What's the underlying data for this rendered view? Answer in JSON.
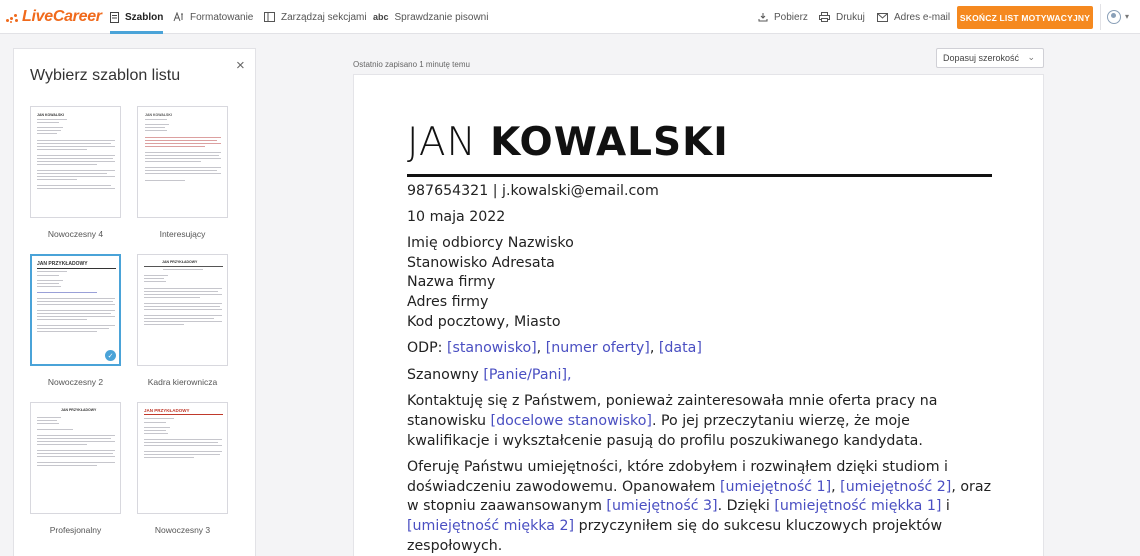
{
  "logo": {
    "text": "LiveCareer"
  },
  "nav": {
    "tabs": [
      {
        "label": "Szablon",
        "icon": "document-icon"
      },
      {
        "label": "Formatowanie",
        "icon": "format-icon"
      },
      {
        "label": "Zarządzaj sekcjami",
        "icon": "sections-icon"
      },
      {
        "label": "Sprawdzanie pisowni",
        "icon": "spellcheck-icon"
      }
    ],
    "actions": [
      {
        "label": "Pobierz",
        "icon": "download-icon"
      },
      {
        "label": "Drukuj",
        "icon": "print-icon"
      },
      {
        "label": "Adres e-mail",
        "icon": "mail-icon"
      }
    ],
    "finish_button": "SKOŃCZ LIST MOTYWACYJNY",
    "spellcheck_glyph": "abc"
  },
  "panel": {
    "title": "Wybierz szablon listu",
    "close": "×",
    "templates": [
      {
        "label": "Nowoczesny 4",
        "heading": "JAN KOWALSKI"
      },
      {
        "label": "Interesujący",
        "heading": "JAN KOWALSKI"
      },
      {
        "label": "Nowoczesny 2",
        "heading": "JAN PRZYKŁADOWY"
      },
      {
        "label": "Kadra kierownicza",
        "heading": "JAN PRZYKŁADOWY"
      },
      {
        "label": "Profesjonalny",
        "heading": "JAN PRZYKŁADOWY"
      },
      {
        "label": "Nowoczesny 3",
        "heading": "JAN PRZYKŁADOWY"
      }
    ],
    "selected_check": "✓"
  },
  "main": {
    "saved_status": "Ostatnio zapisano 1 minutę temu",
    "zoom": "Dopasuj szerokość"
  },
  "letter": {
    "first_name": "JAN",
    "last_name": "KOWALSKI",
    "contact": "987654321 | j.kowalski@email.com",
    "date": "10 maja 2022",
    "recipient_lines": [
      "Imię odbiorcy Nazwisko",
      "Stanowisko Adresata",
      "Nazwa firmy",
      "Adres firmy",
      "Kod pocztowy, Miasto"
    ],
    "re_prefix": "ODP: ",
    "re_position": "[stanowisko]",
    "re_sep1": ", ",
    "re_number": "[numer oferty]",
    "re_sep2": ", ",
    "re_date": "[data]",
    "greeting_prefix": "Szanowny ",
    "greeting_name": "[Panie/Pani],",
    "p1_a": "Kontaktuję się z Państwem, ponieważ zainteresowała mnie oferta pracy na stanowisku ",
    "p1_link": "[docelowe stanowisko]",
    "p1_b": ". Po jej przeczytaniu wierzę, że moje kwalifikacje i wykształcenie pasują do profilu poszukiwanego kandydata.",
    "p2_a": "Oferuję Państwu umiejętności, które zdobyłem i rozwinąłem dzięki studiom i doświadczeniu zawodowemu. Opanowałem ",
    "p2_l1": "[umiejętność 1]",
    "p2_s1": ", ",
    "p2_l2": "[umiejętność 2]",
    "p2_b": ", oraz w stopniu zaawansowanym ",
    "p2_l3": "[umiejętność 3]",
    "p2_c": ". Dzięki ",
    "p2_l4": "[umiejętność miękka 1]",
    "p2_d": " i ",
    "p2_l5": "[umiejętność miękka 2]",
    "p2_e": " przyczyniłem się do sukcesu kluczowych projektów zespołowych."
  },
  "colors": {
    "accent": "#f5891f",
    "logo": "#f06a1c",
    "active_tab": "#4aa3d8",
    "placeholder_link": "#4a4fc2"
  }
}
